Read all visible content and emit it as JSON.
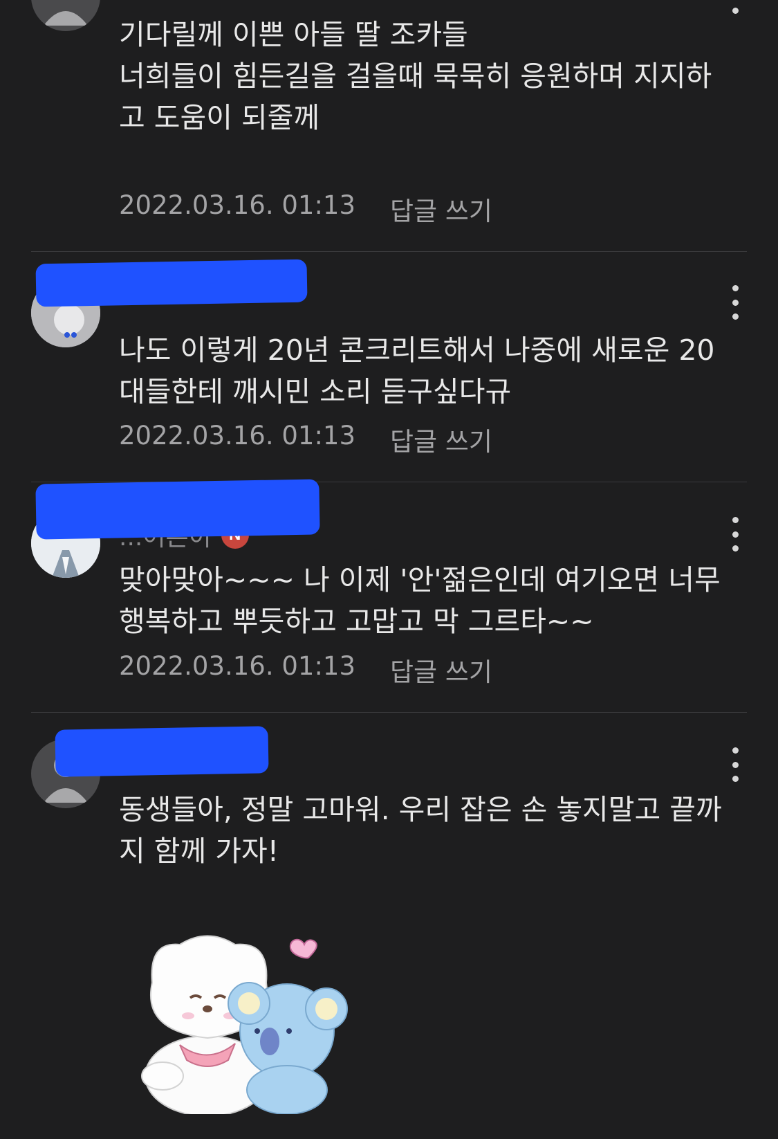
{
  "comments": [
    {
      "nickname": "",
      "text": "기다릴께 이쁜 아들 딸 조카들\n너희들이 힘든길을 걸을때 묵묵히 응원하며 지지하고 도움이 되줄께",
      "timestamp": "2022.03.16. 01:13",
      "reply_label": "답글 쓰기"
    },
    {
      "nickname": "",
      "text": "나도 이렇게 20년 콘크리트해서 나중에 새로운 20대들한테 깨시민 소리 듣구싶다규",
      "timestamp": "2022.03.16. 01:13",
      "reply_label": "답글 쓰기"
    },
    {
      "nickname": "...어른이",
      "badge": "N",
      "text": "맞아맞아~~~ 나 이제 '안'젊은인데 여기오면 너무 행복하고 뿌듯하고 고맙고 막 그르타~~",
      "timestamp": "2022.03.16. 01:13",
      "reply_label": "답글 쓰기"
    },
    {
      "nickname": "",
      "text": "동생들아, 정말 고마워. 우리 잡은 손 놓지말고 끝까지 함께 가자!",
      "sticker": "RJ and Koya hugging sticker"
    }
  ],
  "colors": {
    "background": "#1e1e1f",
    "text": "#e8e8e8",
    "meta": "#a4a4a6",
    "badge": "#c8463d",
    "redaction": "#1f52ff"
  },
  "icons": [
    "default-avatar-icon",
    "more-options-icon",
    "naver-badge-icon"
  ]
}
